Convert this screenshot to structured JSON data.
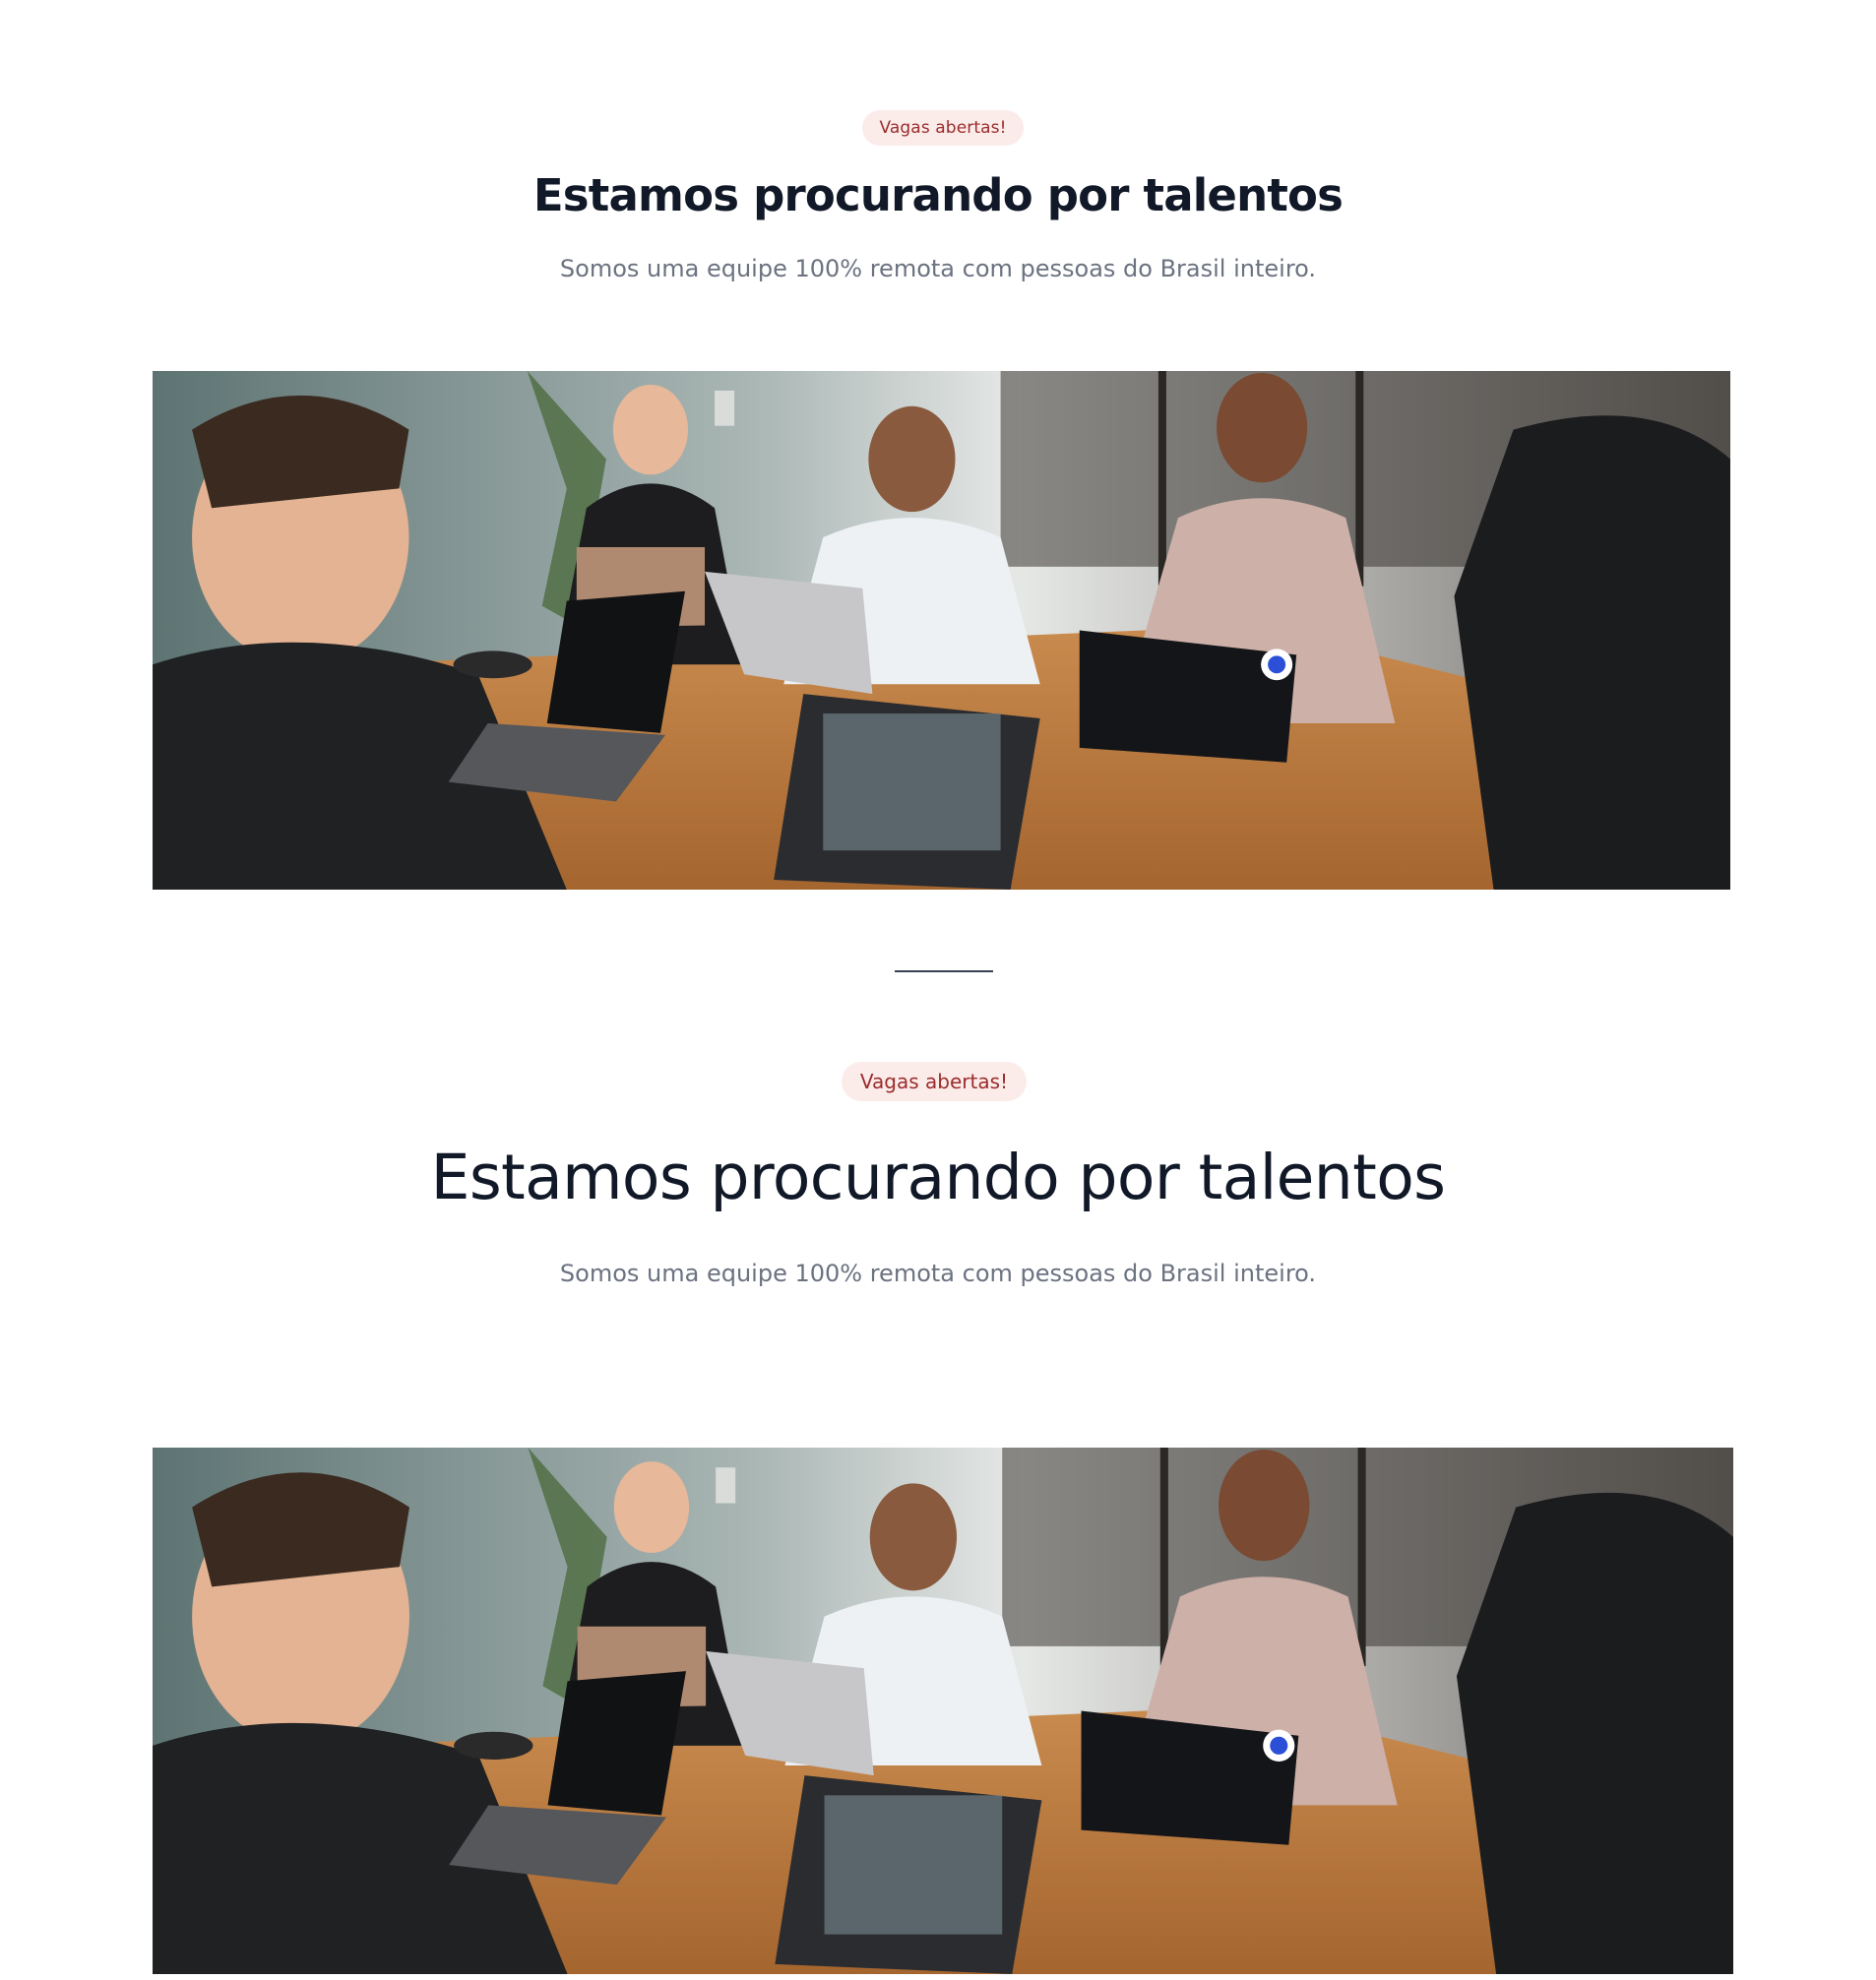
{
  "sections": [
    {
      "badge": "Vagas abertas!",
      "title": "Estamos procurando por talentos",
      "subtitle": "Somos uma equipe 100% remota com pessoas do Brasil inteiro.",
      "image": "team-meeting-photo"
    },
    {
      "badge": "Vagas abertas!",
      "title": "Estamos procurando por talentos",
      "subtitle": "Somos uma equipe 100% remota com pessoas do Brasil inteiro.",
      "image": "team-meeting-photo"
    }
  ],
  "colors": {
    "badge_bg": "#fbecea",
    "badge_text": "#9b2c2c",
    "heading": "#111827",
    "muted": "#6b7280",
    "divider": "#374151"
  }
}
